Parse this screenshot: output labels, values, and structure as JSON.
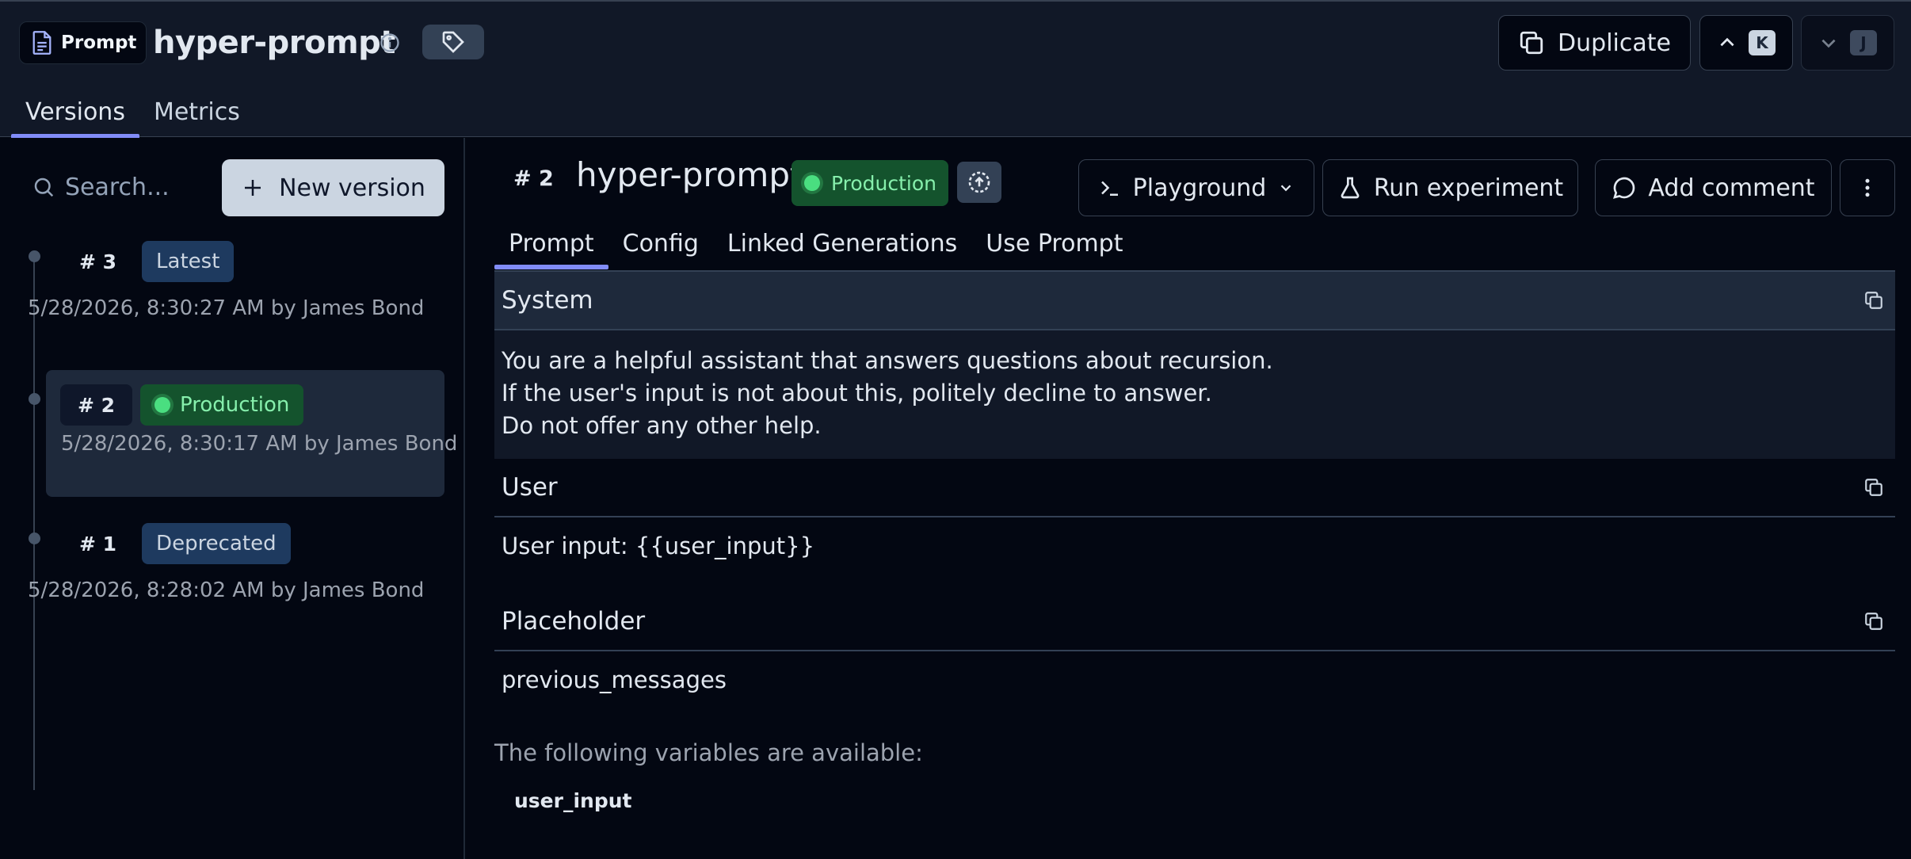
{
  "header": {
    "type_badge": "Prompt",
    "prompt_name": "hyper-prompt",
    "duplicate_label": "Duplicate",
    "prev_shortcut": "K",
    "next_shortcut": "J"
  },
  "top_tabs": [
    {
      "label": "Versions",
      "active": true
    },
    {
      "label": "Metrics",
      "active": false
    }
  ],
  "sidebar": {
    "search_placeholder": "Search...",
    "new_version_label": "New version",
    "versions": [
      {
        "number": "# 3",
        "badge": "Latest",
        "meta": "5/28/2026, 8:30:27 AM by James Bond",
        "selected": false
      },
      {
        "number": "# 2",
        "badge": "Production",
        "meta": "5/28/2026, 8:30:17 AM by James Bond",
        "selected": true
      },
      {
        "number": "# 1",
        "badge": "Deprecated",
        "meta": "5/28/2026, 8:28:02 AM by James Bond",
        "selected": false
      }
    ]
  },
  "main": {
    "version_label": "# 2",
    "title": "hyper-prompt",
    "status_badge": "Production",
    "actions": {
      "playground": "Playground",
      "run_experiment": "Run experiment",
      "add_comment": "Add comment"
    },
    "tabs": [
      {
        "label": "Prompt",
        "active": true
      },
      {
        "label": "Config",
        "active": false
      },
      {
        "label": "Linked Generations",
        "active": false
      },
      {
        "label": "Use Prompt",
        "active": false
      }
    ],
    "messages": [
      {
        "role": "System",
        "lines": [
          "You are a helpful assistant that answers questions about recursion.",
          "If the user's input is not about this, politely decline to answer.",
          "Do not offer any other help."
        ]
      },
      {
        "role": "User",
        "lines": [
          "User input: {{user_input}}"
        ]
      },
      {
        "role": "Placeholder",
        "lines": [
          "previous_messages"
        ]
      }
    ],
    "variables_label": "The following variables are available:",
    "variables": [
      "user_input"
    ]
  },
  "colors": {
    "background": "#030712",
    "header_bg": "#111827",
    "accent": "#818cf8",
    "production_bg": "#14532d",
    "production_text": "#86efac"
  }
}
